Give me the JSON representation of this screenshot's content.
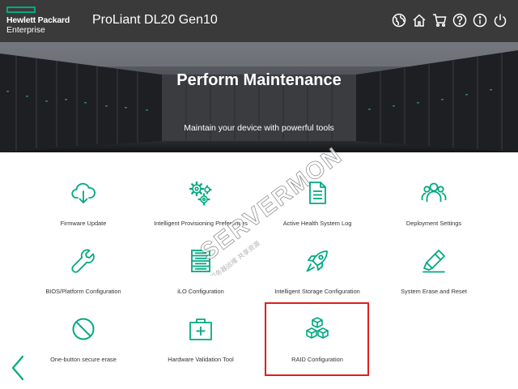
{
  "header": {
    "logo_line1": "Hewlett Packard",
    "logo_line2": "Enterprise",
    "product": "ProLiant DL20 Gen10",
    "icons": [
      "globe-icon",
      "home-icon",
      "cart-icon",
      "help-icon",
      "info-icon",
      "power-icon"
    ]
  },
  "hero": {
    "title": "Perform Maintenance",
    "subtitle": "Maintain your device with powerful tools"
  },
  "tiles": [
    {
      "label": "Firmware Update",
      "icon": "cloud-download-icon"
    },
    {
      "label": "Intelligent Provisioning Preferences",
      "icon": "gears-icon"
    },
    {
      "label": "Active Health System Log",
      "icon": "document-icon"
    },
    {
      "label": "Deployment Settings",
      "icon": "users-icon"
    },
    {
      "label": "BIOS/Platform Configuration",
      "icon": "wrench-icon"
    },
    {
      "label": "iLO Configuration",
      "icon": "server-rack-icon"
    },
    {
      "label": "Intelligent Storage Configuration",
      "icon": "rocket-icon"
    },
    {
      "label": "System Erase and Reset",
      "icon": "erase-icon"
    },
    {
      "label": "One-button secure erase",
      "icon": "prohibited-icon"
    },
    {
      "label": "Hardware Validation Tool",
      "icon": "medkit-icon"
    },
    {
      "label": "RAID Configuration",
      "icon": "cubes-icon"
    }
  ],
  "colors": {
    "accent": "#01a982",
    "header_bg": "#3a3a3a",
    "highlight": "#e01e1e"
  },
  "watermark": {
    "text": "SERVERMON",
    "subtext": "服务器运维 共享资源"
  }
}
